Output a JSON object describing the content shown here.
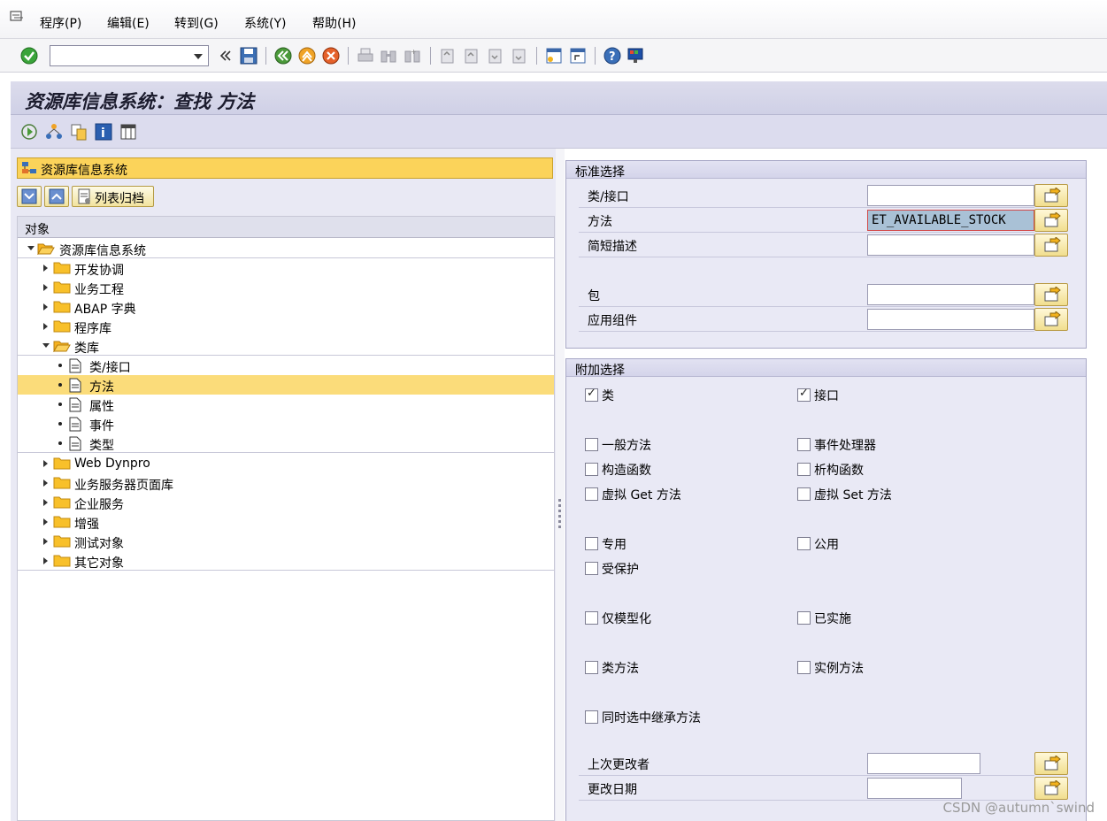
{
  "menu": {
    "items": [
      "程序(P)",
      "编辑(E)",
      "转到(G)",
      "系统(Y)",
      "帮助(H)"
    ]
  },
  "systoolbar": {
    "command_value": ""
  },
  "title": "资源库信息系统：查找 方法",
  "left": {
    "header": "资源库信息系统",
    "archive_button": "列表归档",
    "tree_column": "对象",
    "tree": [
      {
        "label": "资源库信息系统",
        "level": 0,
        "expanded": true,
        "type": "folder"
      },
      {
        "label": "开发协调",
        "level": 1,
        "type": "folder"
      },
      {
        "label": "业务工程",
        "level": 1,
        "type": "folder"
      },
      {
        "label": "ABAP 字典",
        "level": 1,
        "type": "folder"
      },
      {
        "label": "程序库",
        "level": 1,
        "type": "folder"
      },
      {
        "label": "类库",
        "level": 1,
        "expanded": true,
        "type": "folder"
      },
      {
        "label": "类/接口",
        "level": 2,
        "type": "doc"
      },
      {
        "label": "方法",
        "level": 2,
        "type": "doc",
        "selected": true
      },
      {
        "label": "属性",
        "level": 2,
        "type": "doc"
      },
      {
        "label": "事件",
        "level": 2,
        "type": "doc"
      },
      {
        "label": "类型",
        "level": 2,
        "type": "doc"
      },
      {
        "label": "Web Dynpro",
        "level": 1,
        "type": "folder"
      },
      {
        "label": "业务服务器页面库",
        "level": 1,
        "type": "folder"
      },
      {
        "label": "企业服务",
        "level": 1,
        "type": "folder"
      },
      {
        "label": "增强",
        "level": 1,
        "type": "folder"
      },
      {
        "label": "测试对象",
        "level": 1,
        "type": "folder"
      },
      {
        "label": "其它对象",
        "level": 1,
        "type": "folder"
      }
    ]
  },
  "standard": {
    "title": "标准选择",
    "fields": [
      {
        "label": "类/接口",
        "value": ""
      },
      {
        "label": "方法",
        "value": "ET_AVAILABLE_STOCK"
      },
      {
        "label": "简短描述",
        "value": ""
      },
      {
        "label": "包",
        "value": ""
      },
      {
        "label": "应用组件",
        "value": ""
      }
    ]
  },
  "additional": {
    "title": "附加选择",
    "checkboxes": {
      "class": {
        "label": "类",
        "checked": true
      },
      "interface": {
        "label": "接口",
        "checked": true
      },
      "general": {
        "label": "一般方法",
        "checked": false
      },
      "event_handler": {
        "label": "事件处理器",
        "checked": false
      },
      "constructor": {
        "label": "构造函数",
        "checked": false
      },
      "destructor": {
        "label": "析构函数",
        "checked": false
      },
      "virtual_get": {
        "label": "虚拟 Get 方法",
        "checked": false
      },
      "virtual_set": {
        "label": "虚拟 Set 方法",
        "checked": false
      },
      "private": {
        "label": "专用",
        "checked": false
      },
      "public": {
        "label": "公用",
        "checked": false
      },
      "protected": {
        "label": "受保护",
        "checked": false
      },
      "modeled": {
        "label": "仅模型化",
        "checked": false
      },
      "implemented": {
        "label": "已实施",
        "checked": false
      },
      "class_method": {
        "label": "类方法",
        "checked": false
      },
      "instance_method": {
        "label": "实例方法",
        "checked": false
      },
      "inherited": {
        "label": "同时选中继承方法",
        "checked": false
      }
    },
    "last_changed_by": {
      "label": "上次更改者",
      "value": ""
    },
    "changed_on": {
      "label": "更改日期",
      "value": ""
    }
  },
  "watermark": "CSDN @autumn`swind",
  "colors": {
    "selection": "#fbdc7a",
    "header_yellow": "#fbd35a",
    "group_bg": "#e9e9f5",
    "highlight_field": "#a9c1d6"
  }
}
